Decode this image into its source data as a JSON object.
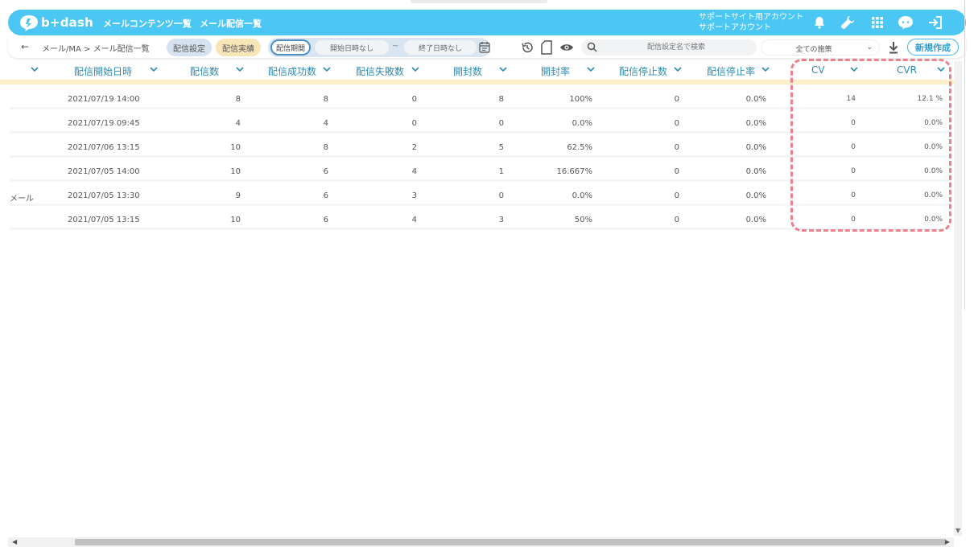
{
  "header": {
    "logo": "b+dash",
    "nav": [
      "メールコンテンツ一覧",
      "メール配信一覧"
    ],
    "account_line1": "サポートサイト用アカウント",
    "account_line2": "サポートアカウント",
    "icons": [
      "bell-icon",
      "wrench-icon",
      "grid-icon",
      "chat-icon",
      "logout-icon"
    ]
  },
  "toolbar": {
    "back": "←",
    "breadcrumb": "メール/MA > メール配信一覧",
    "tab_settings": "配信設定",
    "tab_results": "配信実績",
    "period_label": "配信期間",
    "start_date": "開始日時なし",
    "tilde": "~",
    "end_date": "終了日時なし",
    "search_placeholder": "配信設定名で検索",
    "select_value": "全ての施策",
    "new_button": "新規作成"
  },
  "table": {
    "columns": [
      "配信開始日時",
      "配信数",
      "配信成功数",
      "配信失敗数",
      "開封数",
      "開封率",
      "配信停止数",
      "配信停止率",
      "CV",
      "CVR"
    ],
    "rows": [
      {
        "name": "",
        "date": "2021/07/19 14:00",
        "sent": "8",
        "success": "8",
        "fail": "0",
        "opened": "8",
        "open_rate": "100%",
        "unsub": "0",
        "unsub_rate": "0.0%",
        "cv": "14",
        "cvr": "12.1 %"
      },
      {
        "name": "",
        "date": "2021/07/19 09:45",
        "sent": "4",
        "success": "4",
        "fail": "0",
        "opened": "0",
        "open_rate": "0.0%",
        "unsub": "0",
        "unsub_rate": "0.0%",
        "cv": "0",
        "cvr": "0.0%"
      },
      {
        "name": "",
        "date": "2021/07/06 13:15",
        "sent": "10",
        "success": "8",
        "fail": "2",
        "opened": "5",
        "open_rate": "62.5%",
        "unsub": "0",
        "unsub_rate": "0.0%",
        "cv": "0",
        "cvr": "0.0%"
      },
      {
        "name": "",
        "date": "2021/07/05 14:00",
        "sent": "10",
        "success": "6",
        "fail": "4",
        "opened": "1",
        "open_rate": "16.667%",
        "unsub": "0",
        "unsub_rate": "0.0%",
        "cv": "0",
        "cvr": "0.0%"
      },
      {
        "name": "メール",
        "date": "2021/07/05 13:30",
        "sent": "9",
        "success": "6",
        "fail": "3",
        "opened": "0",
        "open_rate": "0.0%",
        "unsub": "0",
        "unsub_rate": "0.0%",
        "cv": "0",
        "cvr": "0.0%"
      },
      {
        "name": "",
        "date": "2021/07/05 13:15",
        "sent": "10",
        "success": "6",
        "fail": "4",
        "opened": "3",
        "open_rate": "50%",
        "unsub": "0",
        "unsub_rate": "0.0%",
        "cv": "0",
        "cvr": "0.0%"
      }
    ]
  },
  "colors": {
    "header_bg": "#4cc7f4",
    "accent": "#2e8bb0",
    "highlight_dash": "#ef7f8c",
    "results_tab": "#f9e6b8"
  }
}
